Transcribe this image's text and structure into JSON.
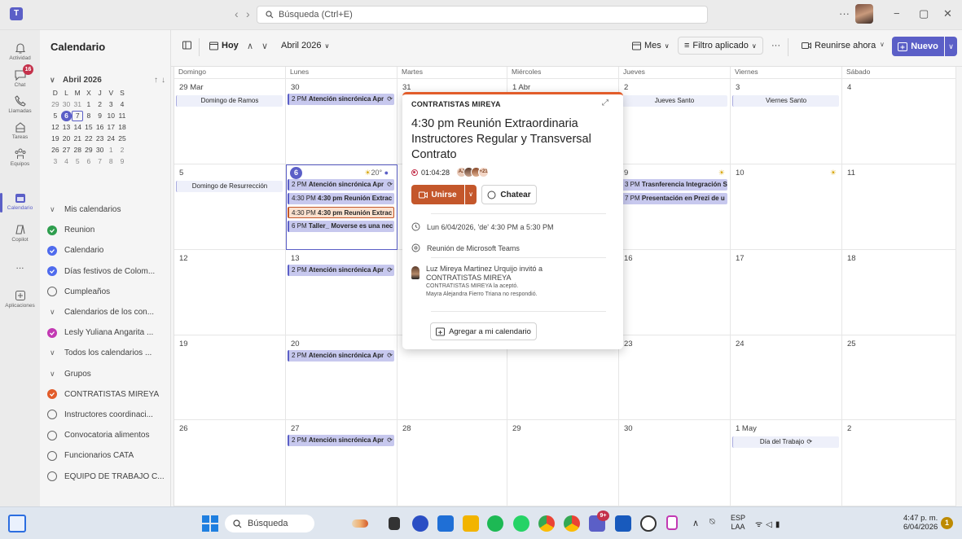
{
  "window": {
    "search_placeholder": "Búsqueda (Ctrl+E)",
    "more_label": "···"
  },
  "rail": [
    {
      "label": "Actividad",
      "icon": "bell-icon"
    },
    {
      "label": "Chat",
      "icon": "chat-icon",
      "badge": "16"
    },
    {
      "label": "Llamadas",
      "icon": "phone-icon"
    },
    {
      "label": "Tareas",
      "icon": "tasks-icon"
    },
    {
      "label": "Equipos",
      "icon": "teams-icon"
    },
    {
      "label": "Calendario",
      "icon": "calendar-icon",
      "active": true
    },
    {
      "label": "Copilot",
      "icon": "copilot-icon"
    },
    {
      "label": "...",
      "icon": "more-icon"
    },
    {
      "label": "Aplicaciones",
      "icon": "apps-icon"
    }
  ],
  "sidebar": {
    "title": "Calendario",
    "minical": {
      "month": "Abril 2026",
      "weekdays": [
        "D",
        "L",
        "M",
        "X",
        "J",
        "V",
        "S"
      ],
      "weeks": [
        [
          "29",
          "30",
          "31",
          "1",
          "2",
          "3",
          "4"
        ],
        [
          "5",
          "6",
          "7",
          "8",
          "9",
          "10",
          "11"
        ],
        [
          "12",
          "13",
          "14",
          "15",
          "16",
          "17",
          "18"
        ],
        [
          "19",
          "20",
          "21",
          "22",
          "23",
          "24",
          "25"
        ],
        [
          "26",
          "27",
          "28",
          "29",
          "30",
          "1",
          "2"
        ],
        [
          "3",
          "4",
          "5",
          "6",
          "7",
          "8",
          "9"
        ]
      ]
    },
    "calendars": [
      {
        "type": "header",
        "label": "Mis calendarios"
      },
      {
        "label": "Reunion",
        "color": "#2e9e4e",
        "checked": true
      },
      {
        "label": "Calendario",
        "color": "#4f6bed",
        "checked": true
      },
      {
        "label": "Días festivos de Colom...",
        "color": "#4f6bed",
        "checked": true
      },
      {
        "label": "Cumpleaños",
        "checked": false
      },
      {
        "type": "header",
        "label": "Calendarios de los con..."
      },
      {
        "label": "Lesly Yuliana Angarita ...",
        "color": "#c239b3",
        "checked": true
      },
      {
        "type": "header",
        "label": "Todos los calendarios ..."
      },
      {
        "type": "header",
        "label": "Grupos"
      },
      {
        "label": "CONTRATISTAS MIREYA",
        "color": "#e25c2a",
        "checked": true
      },
      {
        "label": "Instructores coordinaci...",
        "checked": false
      },
      {
        "label": "Convocatoria alimentos",
        "checked": false
      },
      {
        "label": "Funcionarios CATA",
        "checked": false
      },
      {
        "label": "EQUIPO DE TRABAJO C...",
        "checked": false
      }
    ]
  },
  "toolbar": {
    "today_label": "Hoy",
    "month_label": "Abril 2026",
    "view_label": "Mes",
    "filter_label": "Filtro aplicado",
    "more_label": "···",
    "meet_now_label": "Reunirse ahora",
    "new_label": "Nuevo"
  },
  "calendar": {
    "weekdays": [
      "Domingo",
      "Lunes",
      "Martes",
      "Miércoles",
      "Jueves",
      "Viernes",
      "Sábado"
    ],
    "weeks": [
      [
        "29 Mar",
        "30",
        "31",
        "1 Abr",
        "2",
        "3",
        "4"
      ],
      [
        "5",
        "6",
        "7",
        "8",
        "9",
        "10",
        "11"
      ],
      [
        "12",
        "13",
        "14",
        "15",
        "16",
        "17",
        "18"
      ],
      [
        "19",
        "20",
        "21",
        "22",
        "23",
        "24",
        "25"
      ],
      [
        "26",
        "27",
        "28",
        "29",
        "30",
        "1 May",
        "2"
      ]
    ],
    "today": {
      "week": 1,
      "day": 1
    },
    "weather": [
      {
        "week": 1,
        "day": 1,
        "text": "20°"
      },
      {
        "week": 1,
        "day": 4,
        "text": ""
      },
      {
        "week": 1,
        "day": 5,
        "text": ""
      }
    ],
    "events": [
      {
        "week": 0,
        "day": 0,
        "slot": 0,
        "allday": true,
        "text": "Domingo de Ramos"
      },
      {
        "week": 0,
        "day": 1,
        "slot": 0,
        "time": "2 PM",
        "text": "Atención sincrónica Apr",
        "repeat": true
      },
      {
        "week": 0,
        "day": 4,
        "slot": 0,
        "allday": true,
        "text": "Jueves Santo"
      },
      {
        "week": 0,
        "day": 5,
        "slot": 0,
        "allday": true,
        "text": "Viernes Santo"
      },
      {
        "week": 1,
        "day": 0,
        "slot": 0,
        "allday": true,
        "text": "Domingo de Resurrección"
      },
      {
        "week": 1,
        "day": 1,
        "slot": 0,
        "time": "2 PM",
        "text": "Atención sincrónica Apr",
        "repeat": true
      },
      {
        "week": 1,
        "day": 1,
        "slot": 1,
        "time": "4:30 PM",
        "text": "4:30 pm Reunión Extrac"
      },
      {
        "week": 1,
        "day": 1,
        "slot": 2,
        "time": "4:30 PM",
        "text": "4:30 pm Reunión Extrac",
        "selected": true
      },
      {
        "week": 1,
        "day": 1,
        "slot": 3,
        "time": "6 PM",
        "text": "Taller_ Moverse es una nec"
      },
      {
        "week": 1,
        "day": 4,
        "slot": 0,
        "time": "3 PM",
        "text": "Trasnferencia Integración S"
      },
      {
        "week": 1,
        "day": 4,
        "slot": 1,
        "time": "7 PM",
        "text": "Presentación en Prezi de u"
      },
      {
        "week": 2,
        "day": 1,
        "slot": 0,
        "time": "2 PM",
        "text": "Atención sincrónica Apr",
        "repeat": true
      },
      {
        "week": 3,
        "day": 1,
        "slot": 0,
        "time": "2 PM",
        "text": "Atención sincrónica Apr",
        "repeat": true
      },
      {
        "week": 4,
        "day": 1,
        "slot": 0,
        "time": "2 PM",
        "text": "Atención sincrónica Apr",
        "repeat": true
      },
      {
        "week": 4,
        "day": 5,
        "slot": 0,
        "allday": true,
        "text": "Día del Trabajo",
        "repeat": true
      }
    ]
  },
  "popup": {
    "organizer": "CONTRATISTAS MIREYA",
    "title": "4:30 pm Reunión Extraordinaria Instructores Regular y Transversal Contrato",
    "timer": "01:04:28",
    "avatar_initials": "AJ",
    "extra_count": "+21",
    "join_label": "Unirse",
    "chat_label": "Chatear",
    "datetime": "Lun 6/04/2026, 'de' 4:30 PM a 5:30 PM",
    "location": "Reunión de Microsoft Teams",
    "invite_line1": "Luz Mireya Martinez Urquijo invitó a",
    "invite_line2": "CONTRATISTAS MIREYA",
    "accepted": "CONTRATISTAS MIREYA la aceptó.",
    "no_response": "Mayra Alejandra Fierro Triana no respondió.",
    "add_label": "Agregar a mi calendario"
  },
  "taskbar": {
    "search_label": "Búsqueda",
    "lang_top": "ESP",
    "lang_bottom": "LAA",
    "time": "4:47 p. m.",
    "date": "6/04/2026",
    "notif_count": "1",
    "badge_teams": "9+"
  }
}
